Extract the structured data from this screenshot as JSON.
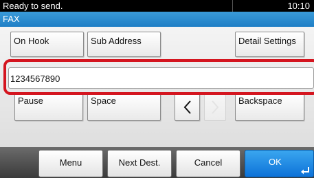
{
  "status": {
    "message": "Ready to send.",
    "time": "10:10"
  },
  "title": "FAX",
  "top_keys": {
    "on_hook": "On Hook",
    "sub_address": "Sub Address",
    "detail_settings": "Detail Settings"
  },
  "number_field": {
    "value": "1234567890"
  },
  "edit_keys": {
    "pause": "Pause",
    "space": "Space",
    "backspace": "Backspace",
    "left_icon": "chevron-left-icon",
    "right_icon": "chevron-right-icon"
  },
  "footer": {
    "menu": "Menu",
    "next_dest": "Next Dest.",
    "cancel": "Cancel",
    "ok": "OK"
  },
  "colors": {
    "accent": "#1f7fc6",
    "ok_button": "#0d72d8",
    "highlight": "#d4151f"
  }
}
